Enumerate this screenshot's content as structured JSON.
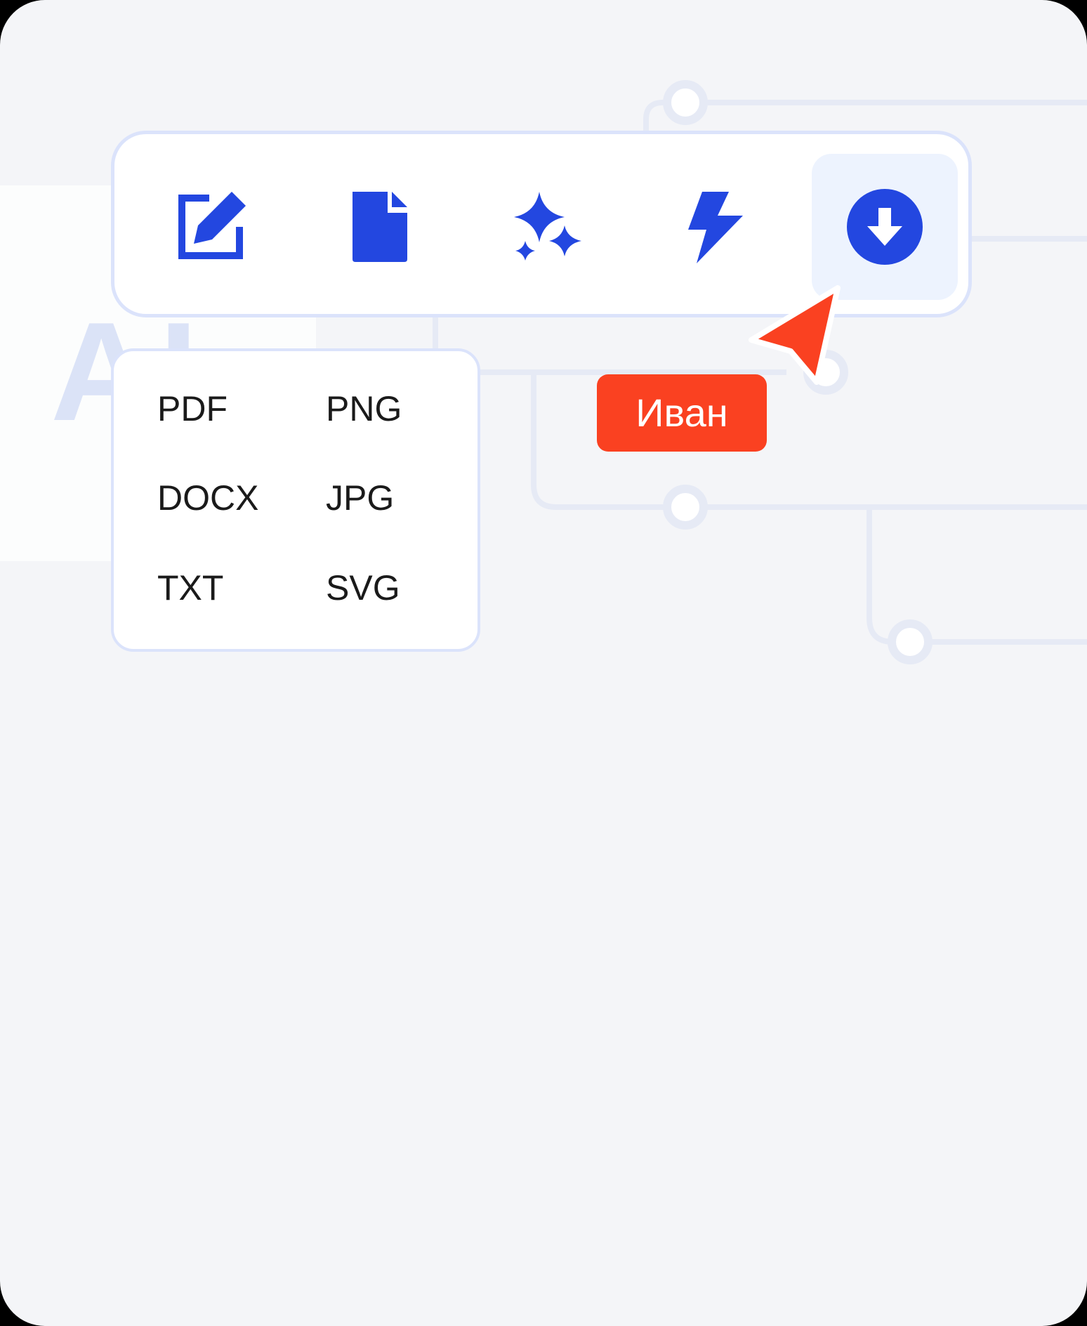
{
  "toolbar": {
    "tools": [
      {
        "icon": "edit-icon",
        "active": false
      },
      {
        "icon": "document-icon",
        "active": false
      },
      {
        "icon": "sparkles-icon",
        "active": false
      },
      {
        "icon": "lightning-icon",
        "active": false
      },
      {
        "icon": "download-icon",
        "active": true
      }
    ]
  },
  "export_menu": {
    "formats": [
      "PDF",
      "PNG",
      "DOCX",
      "JPG",
      "TXT",
      "SVG"
    ]
  },
  "collaborator": {
    "name": "Иван",
    "color": "#fa4121"
  },
  "colors": {
    "accent": "#2347e0",
    "active_bg": "#edf3fe",
    "border": "#dbe3fb",
    "cursor": "#fa4121"
  }
}
